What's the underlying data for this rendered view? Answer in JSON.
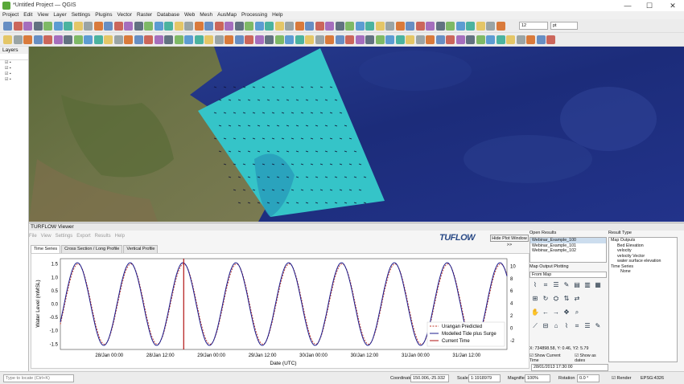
{
  "window": {
    "title": "*Untitled Project — QGIS",
    "minimize_glyph": "—",
    "maximize_glyph": "☐",
    "close_glyph": "✕"
  },
  "menu": [
    "Project",
    "Edit",
    "View",
    "Layer",
    "Settings",
    "Plugins",
    "Vector",
    "Raster",
    "Database",
    "Web",
    "Mesh",
    "AusMap",
    "Processing",
    "Help"
  ],
  "toolbar": {
    "font_size": "12",
    "font_unit": "pt"
  },
  "layers_panel": {
    "title": "Layers",
    "rows": [
      "",
      "",
      "",
      ""
    ]
  },
  "viewer": {
    "title": "TURFLOW Viewer",
    "menu": [
      "File",
      "View",
      "Settings",
      "Export",
      "Results",
      "Help"
    ],
    "logo": "TUFLOW",
    "hide_button": "Hide Plot Window >>",
    "tabs": [
      "Time Series",
      "Cross Section / Long Profile",
      "Vertical Profile"
    ]
  },
  "open_results": {
    "title": "Open Results",
    "items": [
      "Webinar_Example_100",
      "Webinar_Example_101",
      "Webinar_Example_102"
    ]
  },
  "map_output_plotting": {
    "title": "Map Output Plotting",
    "dropdown": "From Map"
  },
  "result_type": {
    "title": "Result Type",
    "map_outputs_label": "Map Outputs",
    "map_outputs": [
      "Bed Elevation",
      "velocity",
      "velocity Vector",
      "water surface elevation"
    ],
    "time_series_label": "Time Series",
    "time_series": [
      "None"
    ]
  },
  "readout": "X: 734898.58, Y: 0.46, Y2: 5.79",
  "checkboxes": {
    "show_current_time": "Show Current Time",
    "show_as_dates": "Show as dates"
  },
  "time_field": "28/01/2013 17:30:00",
  "status": {
    "locate_placeholder": "Type to locate (Ctrl+K)",
    "coordinate_label": "Coordinate",
    "coordinate": "150.006,-25.932",
    "scale_label": "Scale",
    "scale": "1:1918979",
    "magnifier_label": "Magnifier",
    "magnifier": "100%",
    "rotation_label": "Rotation",
    "rotation": "0.0 °",
    "render_label": "Render",
    "crs": "EPSG:4326"
  },
  "chart_data": {
    "type": "line",
    "xlabel": "Date (UTC)",
    "ylabel": "Water Level (mMSL)",
    "ylim": [
      -1.7,
      1.7
    ],
    "y2lim": [
      -3.4,
      11.2
    ],
    "yticks": [
      "-1.5",
      "-1.0",
      "-0.5",
      "0.0",
      "0.5",
      "1.0",
      "1.5"
    ],
    "y2ticks": [
      "-2",
      "0",
      "2",
      "4",
      "6",
      "8",
      "10"
    ],
    "xticks": [
      "28/Jan 00:00",
      "28/Jan 12:00",
      "29/Jan 00:00",
      "29/Jan 12:00",
      "30/Jan 00:00",
      "30/Jan 12:00",
      "31/Jan 00:00",
      "31/Jan 12:00"
    ],
    "x_hours_range": [
      -11.5,
      93.5
    ],
    "tide_amplitude": 1.55,
    "tide_period_hours": 12.42,
    "tide_peak_hour": -7.5,
    "current_time_hour": 17.5,
    "legend_position": "bottom-right",
    "series": [
      {
        "name": "Urangan Predicted",
        "color": "#c0392b",
        "style": "dashed"
      },
      {
        "name": "Modelled Tide plus Surge",
        "color": "#1c1c8c",
        "style": "solid"
      },
      {
        "name": "Current Time",
        "color": "#b21010",
        "style": "solid"
      }
    ]
  }
}
